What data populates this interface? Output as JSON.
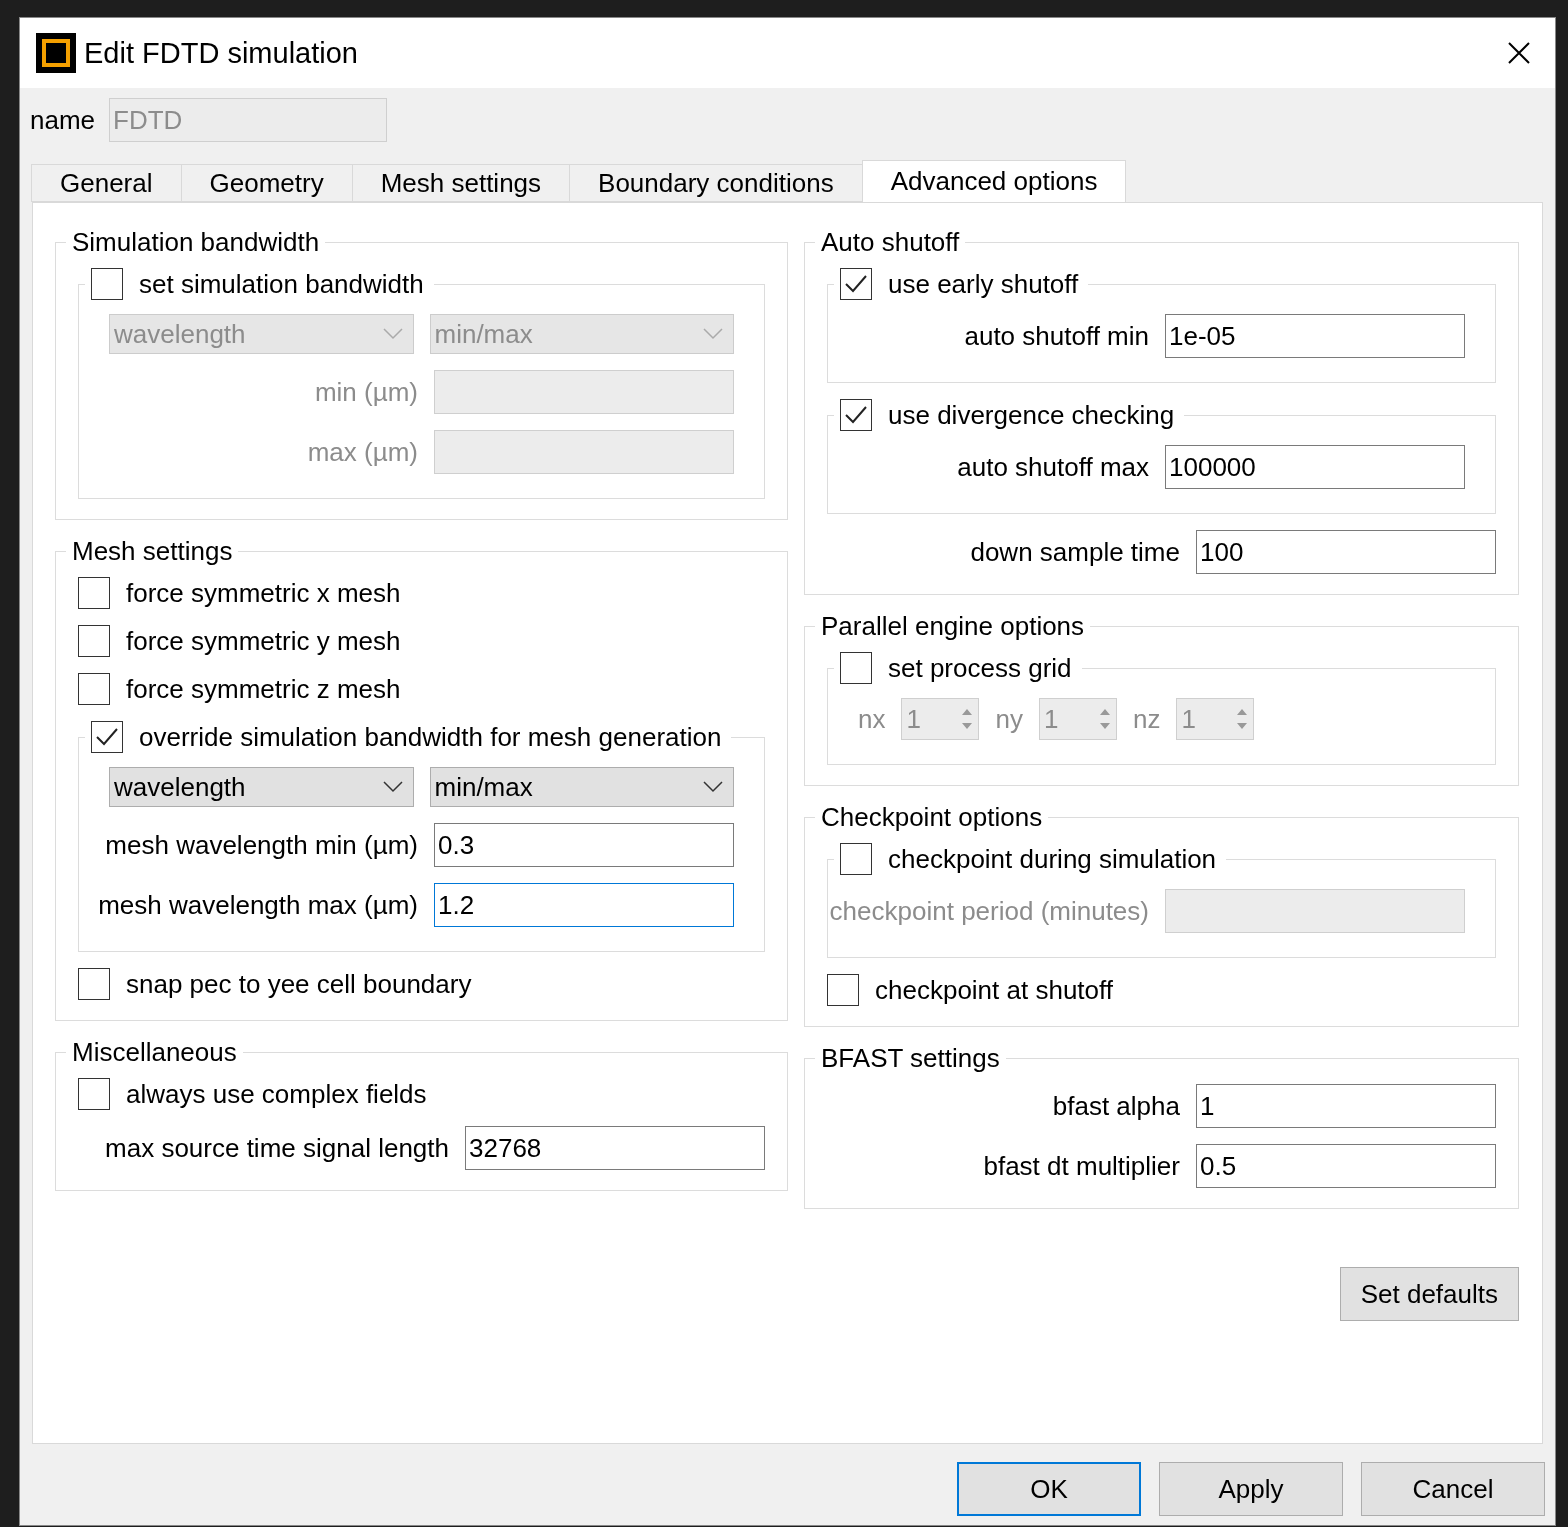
{
  "window": {
    "title": "Edit FDTD simulation"
  },
  "name_field": {
    "label": "name",
    "value": "FDTD",
    "disabled": true
  },
  "tabs": [
    {
      "label": "General",
      "selected": false
    },
    {
      "label": "Geometry",
      "selected": false
    },
    {
      "label": "Mesh settings",
      "selected": false
    },
    {
      "label": "Boundary conditions",
      "selected": false
    },
    {
      "label": "Advanced options",
      "selected": true
    }
  ],
  "left_groups": [
    {
      "title": "Simulation bandwidth",
      "items": [
        {
          "kind": "check_frame",
          "label": "set simulation bandwidth",
          "checked": false,
          "children": [
            {
              "kind": "selects",
              "options": [
                "wavelength",
                "min/max"
              ]
            },
            {
              "kind": "field",
              "label": "min (µm)"
            },
            {
              "kind": "field",
              "label": "max (µm)"
            }
          ]
        }
      ]
    },
    {
      "title": "Mesh settings",
      "items": [
        {
          "kind": "checkbox",
          "label": "force symmetric x mesh",
          "checked": false
        },
        {
          "kind": "checkbox",
          "label": "force symmetric y mesh",
          "checked": false
        },
        {
          "kind": "checkbox",
          "label": "force symmetric z mesh",
          "checked": false
        },
        {
          "kind": "check_frame",
          "label": "override simulation bandwidth for mesh generation",
          "checked": true,
          "children": [
            {
              "kind": "selects",
              "options": [
                "wavelength",
                "min/max"
              ]
            },
            {
              "kind": "field",
              "label": "mesh wavelength min (µm)",
              "value": "0.3"
            },
            {
              "kind": "field",
              "label": "mesh wavelength max (µm)",
              "value": "1.2",
              "focused": true
            }
          ]
        },
        {
          "kind": "checkbox",
          "label": "snap pec to yee cell boundary",
          "checked": false
        }
      ]
    },
    {
      "title": "Miscellaneous",
      "items": [
        {
          "kind": "checkbox",
          "label": "always use complex fields",
          "checked": false
        },
        {
          "kind": "field",
          "label": "max source time signal length",
          "value": "32768"
        }
      ]
    }
  ],
  "right_groups": [
    {
      "title": "Auto shutoff",
      "items": [
        {
          "kind": "check_frame",
          "label": "use early shutoff",
          "checked": true,
          "children": [
            {
              "kind": "field",
              "label": "auto shutoff min",
              "value": "1e-05"
            }
          ]
        },
        {
          "kind": "check_frame",
          "label": "use divergence checking",
          "checked": true,
          "children": [
            {
              "kind": "field",
              "label": "auto shutoff max",
              "value": "100000"
            }
          ]
        },
        {
          "kind": "field",
          "label": "down sample time",
          "value": "100"
        }
      ]
    },
    {
      "title": "Parallel engine options",
      "items": [
        {
          "kind": "check_frame",
          "label": "set process grid",
          "checked": false,
          "children": [
            {
              "kind": "spinners",
              "spinners": [
                {
                  "label": "nx",
                  "value": "1"
                },
                {
                  "label": "ny",
                  "value": "1"
                },
                {
                  "label": "nz",
                  "value": "1"
                }
              ]
            }
          ]
        }
      ]
    },
    {
      "title": "Checkpoint options",
      "items": [
        {
          "kind": "check_frame",
          "label": "checkpoint during simulation",
          "checked": false,
          "children": [
            {
              "kind": "field",
              "label": "checkpoint period (minutes)"
            }
          ]
        },
        {
          "kind": "checkbox",
          "label": "checkpoint at shutoff",
          "checked": false
        }
      ]
    },
    {
      "title": "BFAST settings",
      "items": [
        {
          "kind": "field",
          "label": "bfast alpha",
          "value": "1"
        },
        {
          "kind": "field",
          "label": "bfast dt multiplier",
          "value": "0.5"
        }
      ]
    }
  ],
  "set_defaults": "Set defaults",
  "buttons": [
    {
      "label": "OK",
      "default": true
    },
    {
      "label": "Apply",
      "default": false
    },
    {
      "label": "Cancel",
      "default": false
    }
  ]
}
